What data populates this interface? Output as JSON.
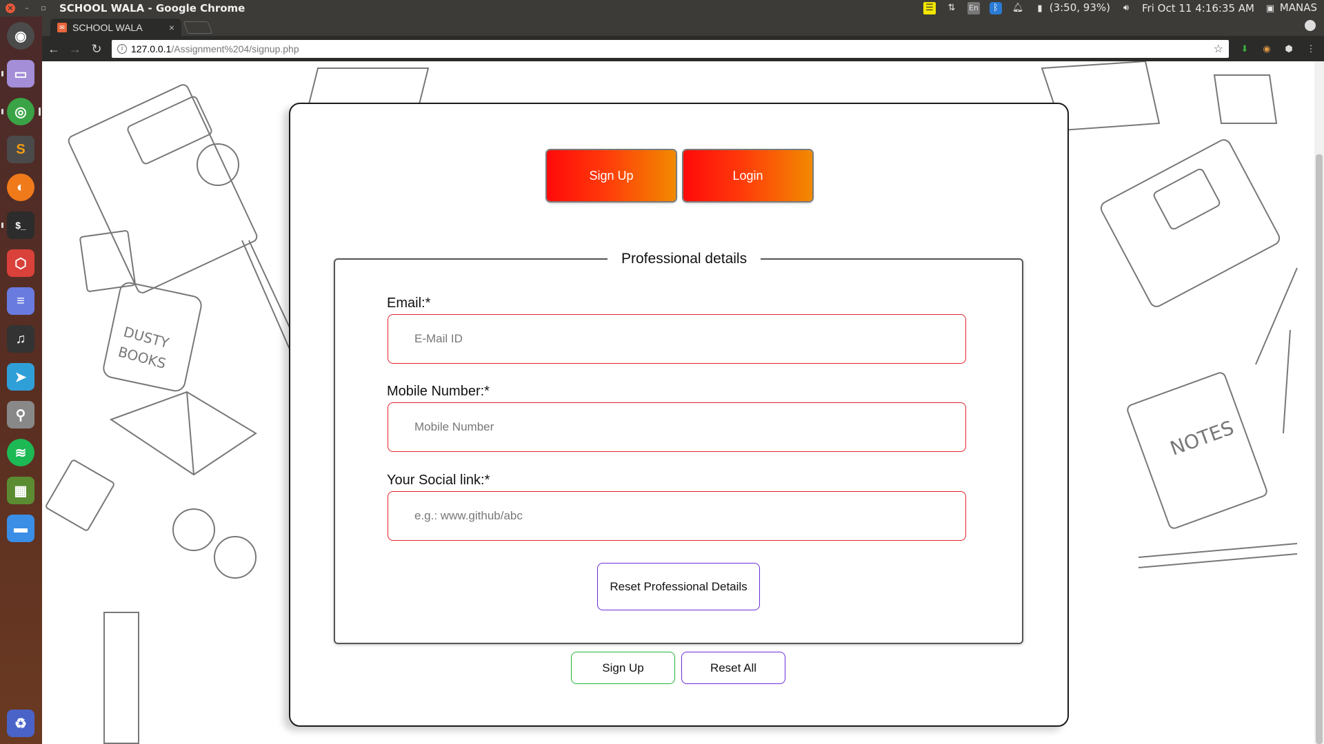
{
  "system": {
    "window_title": "SCHOOL WALA - Google Chrome",
    "battery": "(3:50, 93%)",
    "datetime": "Fri Oct 11  4:16:35 AM",
    "user": "MANAS",
    "lang": "En"
  },
  "browser": {
    "tab_title": "SCHOOL WALA",
    "url_host": "127.0.0.1",
    "url_path": "/Assignment%204/signup.php"
  },
  "form": {
    "signup_toggle": "Sign Up",
    "login_toggle": "Login",
    "legend": "Professional details",
    "email_label": "Email:*",
    "email_placeholder": "E-Mail ID",
    "mobile_label": "Mobile Number:*",
    "mobile_placeholder": "Mobile Number",
    "social_label": "Your Social link:*",
    "social_placeholder": "e.g.: www.github/abc",
    "reset_pro": "Reset Professional Details",
    "signup_submit": "Sign Up",
    "reset_all": "Reset All"
  },
  "colors": {
    "button_gradient_start": "#ff0a0a",
    "button_gradient_end": "#f28a00",
    "input_border": "#e0222a",
    "reset_border": "#6a2bd8",
    "signup_border": "#22b43a"
  },
  "launcher_icons": [
    "ubuntu-icon",
    "files-icon",
    "chrome-icon",
    "sublime-icon",
    "firefox-icon",
    "terminal-icon",
    "app-icon",
    "text-editor-icon",
    "music-icon",
    "telegram-icon",
    "usb-icon",
    "spotify-icon",
    "minecraft-icon",
    "folder-icon",
    "trash-icon"
  ]
}
